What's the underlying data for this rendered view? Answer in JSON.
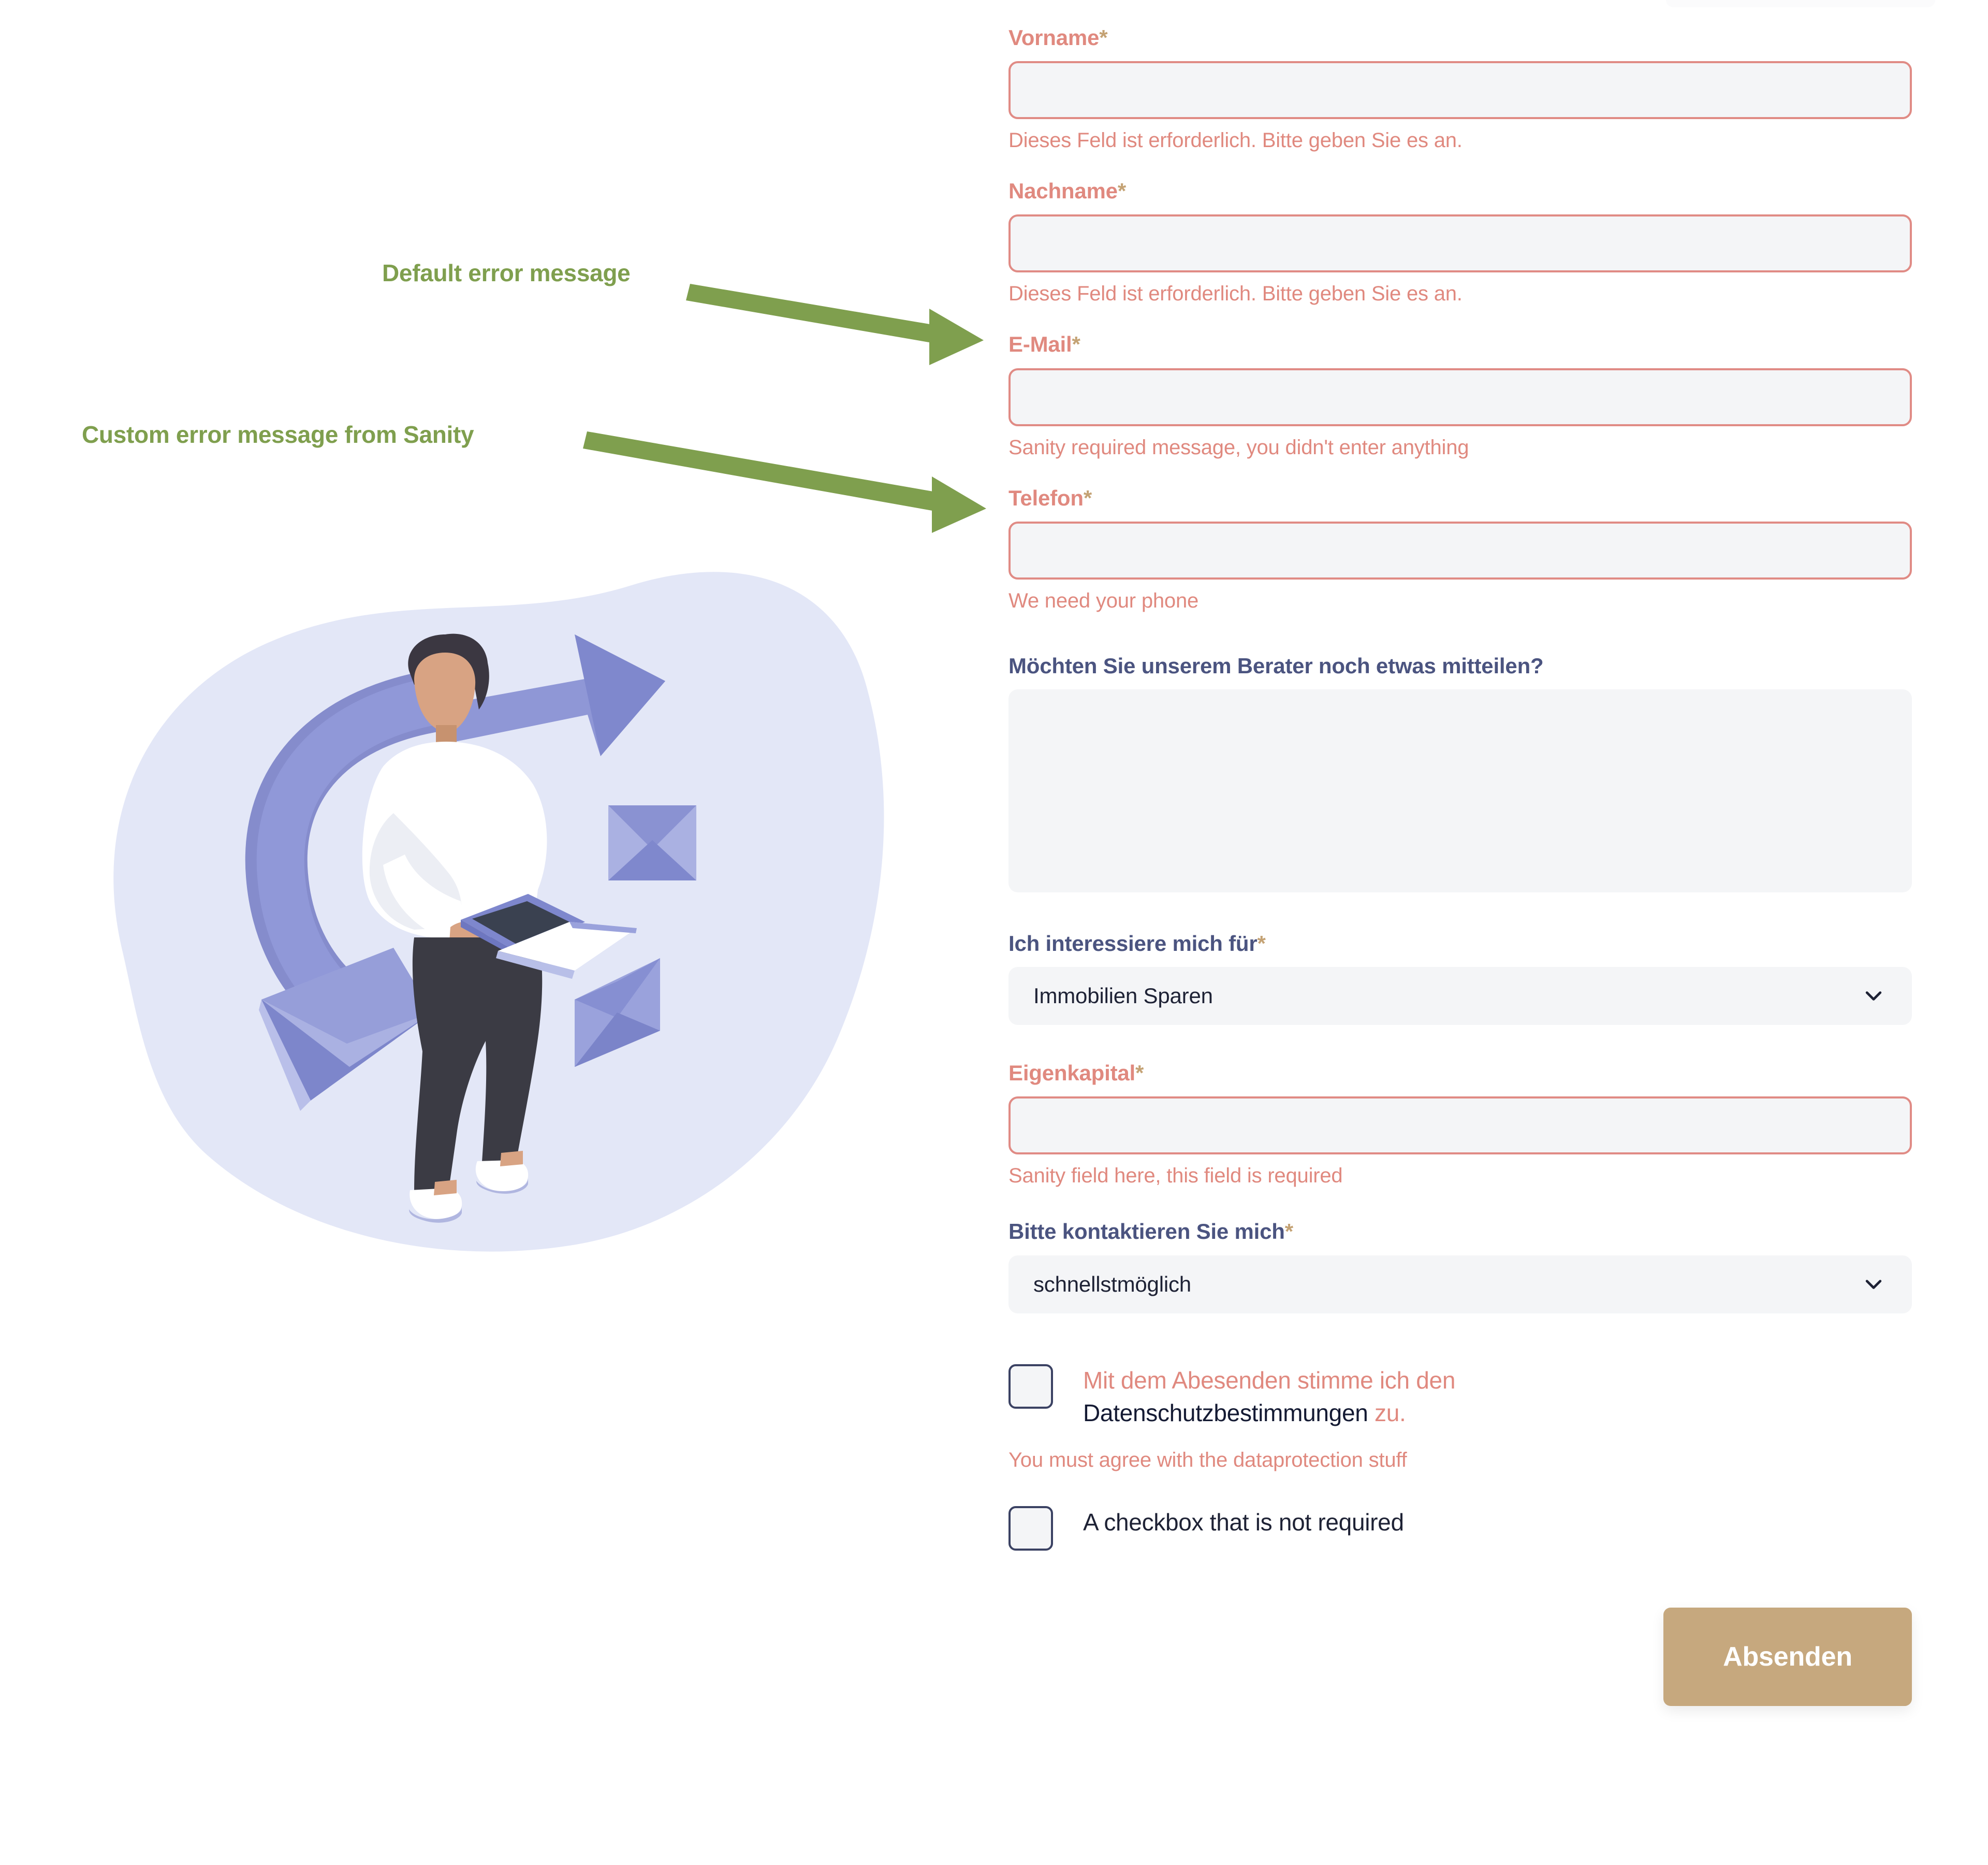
{
  "annotations": {
    "default_error": "Default error message",
    "custom_error": "Custom error message from Sanity",
    "arrow_color": "#7f9f4e"
  },
  "illustration": {
    "name": "person-with-tablet-and-envelopes-illustration",
    "blob_color": "#e3e7f7",
    "accent_color": "#8c93d4",
    "accent_dark": "#6f77c0",
    "shirt_color": "#ffffff",
    "pants_color": "#3b3b44",
    "hair_color": "#3b3741",
    "skin_color": "#d8a383"
  },
  "form": {
    "colors": {
      "error": "#e0897f",
      "error_border": "#e08b85",
      "label_normal": "#4b5480",
      "required_star": "#c4a274",
      "input_fill": "#f4f5f7",
      "checkbox_border": "#3b4263",
      "submit_bg": "#c6a87e",
      "text_dark": "#1e2235"
    },
    "fields": [
      {
        "name": "vorname",
        "label": "Vorname",
        "required": true,
        "label_state": "error",
        "value": "",
        "placeholder": "",
        "error": "Dieses Feld ist erforderlich. Bitte geben Sie es an."
      },
      {
        "name": "nachname",
        "label": "Nachname",
        "required": true,
        "label_state": "error",
        "value": "",
        "placeholder": "",
        "error": "Dieses Feld ist erforderlich. Bitte geben Sie es an."
      },
      {
        "name": "email",
        "label": "E-Mail",
        "required": true,
        "label_state": "error",
        "value": "",
        "placeholder": "",
        "error": "Sanity required message, you didn't enter anything"
      },
      {
        "name": "telefon",
        "label": "Telefon",
        "required": true,
        "label_state": "error",
        "value": "",
        "placeholder": "",
        "error": "We need your phone"
      },
      {
        "name": "nachricht",
        "label": "Möchten Sie unserem Berater noch etwas mitteilen?",
        "required": false,
        "label_state": "normal",
        "value": "",
        "placeholder": "",
        "error": ""
      },
      {
        "name": "interesse",
        "label": "Ich interessiere mich für",
        "required": true,
        "label_state": "normal",
        "value": "Immobilien Sparen",
        "error": ""
      },
      {
        "name": "eigenkapital",
        "label": "Eigenkapital",
        "required": true,
        "label_state": "error",
        "value": "",
        "placeholder": "",
        "error": "Sanity field here, this field is required"
      },
      {
        "name": "kontaktzeit",
        "label": "Bitte kontaktieren Sie mich",
        "required": true,
        "label_state": "normal",
        "value": "schnellstmöglich",
        "error": ""
      }
    ],
    "checkboxes": [
      {
        "name": "datenschutz",
        "state": "error",
        "checked": false,
        "text_before": "Mit dem Abesenden stimme ich den ",
        "link_text": "Datenschutzbestimmungen",
        "text_after": " zu.",
        "error": "You must agree with the dataprotection stuff"
      },
      {
        "name": "optional",
        "state": "normal",
        "checked": false,
        "text_before": "",
        "link_text": "",
        "text_after": "A checkbox that is not required",
        "plain_label": "A checkbox that is not required",
        "error": ""
      }
    ],
    "submit_label": "Absenden"
  }
}
